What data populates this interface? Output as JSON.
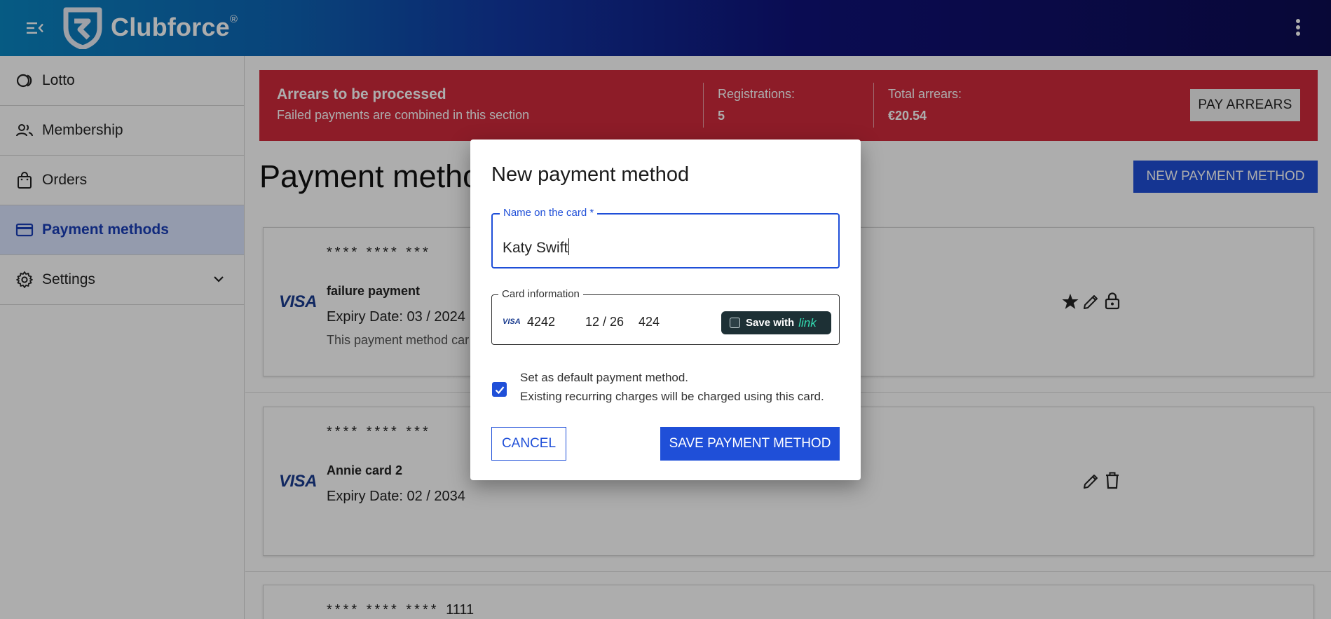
{
  "app": {
    "brand": "Clubforce",
    "trademark": "®"
  },
  "sidebar": {
    "items": [
      {
        "label": "Lotto",
        "icon": "lotto-icon"
      },
      {
        "label": "Membership",
        "icon": "people-icon"
      },
      {
        "label": "Orders",
        "icon": "shopping-bag-icon"
      },
      {
        "label": "Payment methods",
        "icon": "credit-card-icon",
        "active": true
      },
      {
        "label": "Settings",
        "icon": "gear-icon",
        "expandable": true
      }
    ]
  },
  "arrears": {
    "title": "Arrears to be processed",
    "subtitle": "Failed payments are combined in this section",
    "registrations_label": "Registrations:",
    "registrations_value": "5",
    "total_label": "Total arrears:",
    "total_value": "€20.54",
    "pay_button": "PAY ARREARS",
    "color": "#d02a3c"
  },
  "main": {
    "title": "Payment metho",
    "new_button": "NEW PAYMENT METHOD"
  },
  "cards": [
    {
      "brand": "VISA",
      "mask": "**** **** ***",
      "name": "failure payment",
      "expiry": "Expiry Date: 03 / 2024",
      "note": "This payment method car"
    },
    {
      "brand": "VISA",
      "mask": "**** **** ***",
      "name": "Annie card 2",
      "expiry": "Expiry Date: 02 / 2034"
    },
    {
      "mask": "**** **** ****",
      "last4": "1111"
    }
  ],
  "dialog": {
    "title": "New payment method",
    "name_label": "Name on the card *",
    "name_value": "Katy Swift",
    "card_label": "Card information",
    "card_brand": "VISA",
    "card_number": "4242",
    "card_expiry": "12 / 26",
    "card_cvc": "424",
    "link_save": "Save with",
    "link_word": "link",
    "default_checked": true,
    "default_line1": "Set as default payment method.",
    "default_line2": "Existing recurring charges will be charged using this card.",
    "cancel": "CANCEL",
    "save": "SAVE PAYMENT METHOD"
  },
  "colors": {
    "primary": "#1f4fd8",
    "danger": "#d02a3c",
    "active_bg": "#dbe5ff"
  }
}
